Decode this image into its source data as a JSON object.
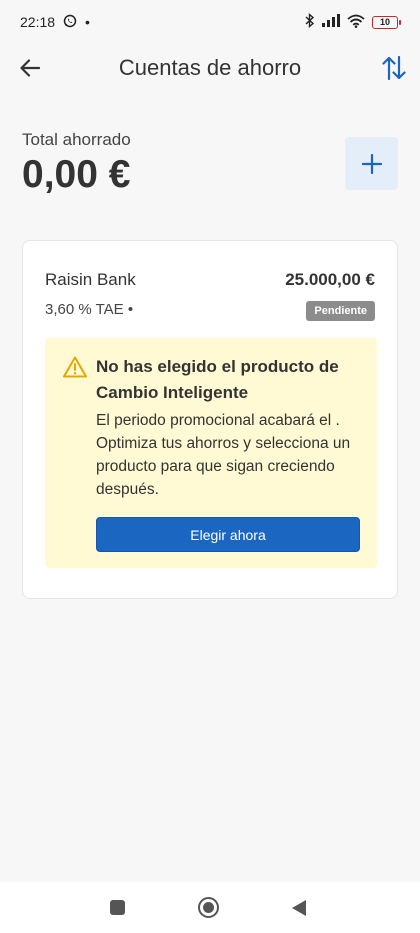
{
  "status_bar": {
    "time": "22:18",
    "notification_dot": "•",
    "battery_level": "10"
  },
  "app_bar": {
    "title": "Cuentas de ahorro",
    "back_icon": "arrow-left-icon",
    "sort_icon": "swap-vertical-icon"
  },
  "summary": {
    "total_label": "Total ahorrado",
    "total_value": "0,00 €",
    "add_icon": "plus-icon"
  },
  "account_card": {
    "bank_name": "Raisin Bank",
    "amount": "25.000,00 €",
    "rate": "3,60 % TAE •",
    "status_badge": "Pendiente",
    "warning": {
      "icon": "warning-triangle-icon",
      "title": "No has elegido el producto de Cambio Inteligente",
      "text": "El periodo promocional acabará el . Optimiza tus ahorros y selecciona un producto para que sigan creciendo después.",
      "button_label": "Elegir ahora"
    }
  },
  "colors": {
    "accent": "#1a66c0",
    "warning_bg": "#fffad3",
    "warning_icon": "#e0a800",
    "badge_bg": "#8c8c8c",
    "add_button_bg": "#e3eef8"
  }
}
